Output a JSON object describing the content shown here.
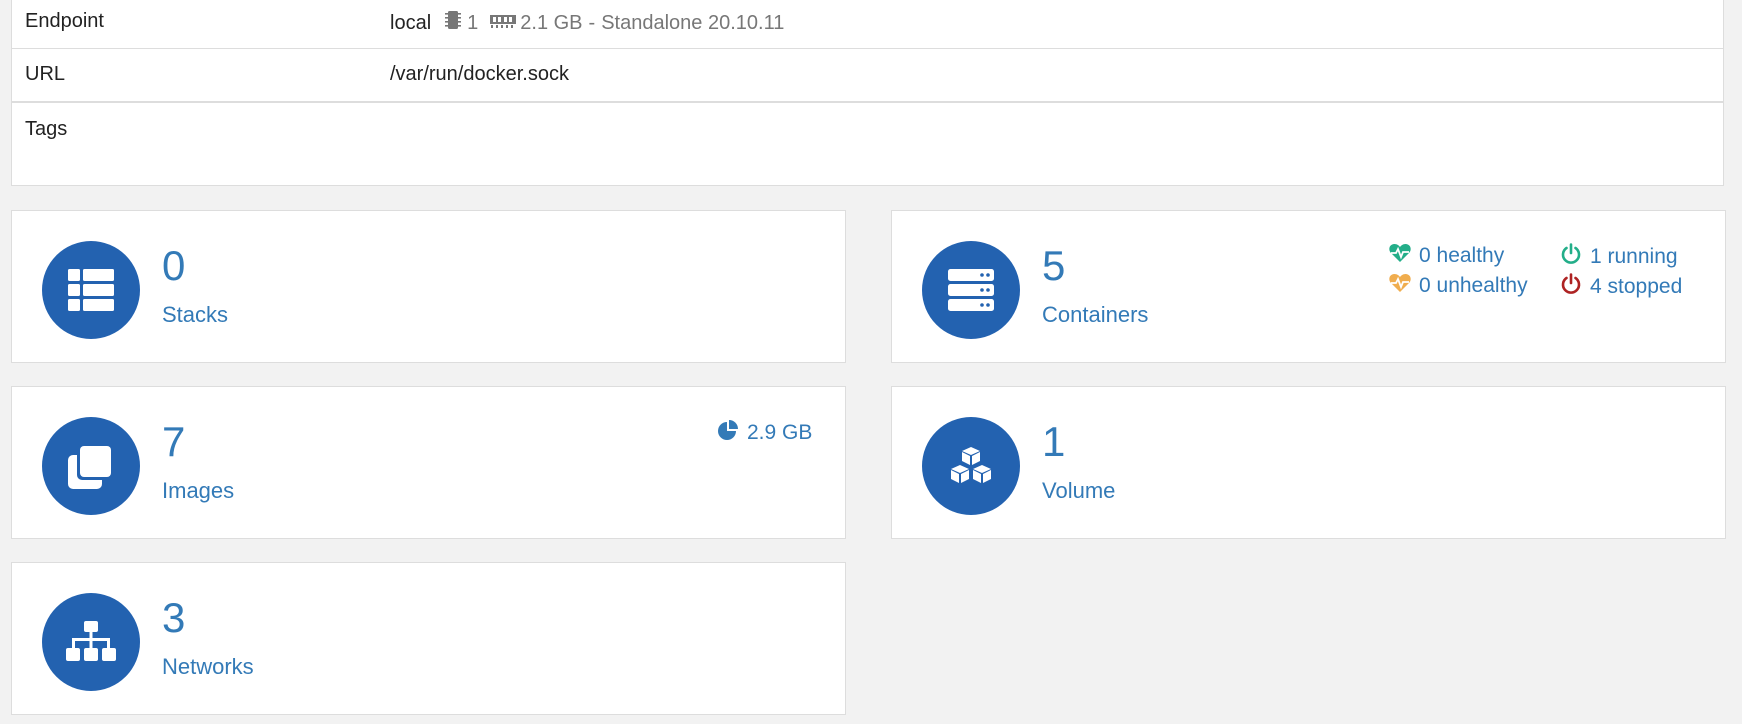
{
  "endpoint_info": {
    "endpoint_label": "Endpoint",
    "endpoint_name": "local",
    "cpu_count": "1",
    "memory": "2.1 GB",
    "separator": "-",
    "docker_mode": "Standalone 20.10.11",
    "url_label": "URL",
    "url_value": "/var/run/docker.sock",
    "tags_label": "Tags"
  },
  "stacks": {
    "count": "0",
    "label": "Stacks",
    "icon": "list-icon"
  },
  "containers": {
    "count": "5",
    "label": "Containers",
    "icon": "server-icon",
    "healthy": "0 healthy",
    "unhealthy": "0 unhealthy",
    "running": "1 running",
    "stopped": "4 stopped"
  },
  "images": {
    "count": "7",
    "label": "Images",
    "icon": "clone-icon",
    "size": "2.9 GB"
  },
  "volumes": {
    "count": "1",
    "label": "Volume",
    "icon": "cubes-icon"
  },
  "networks": {
    "count": "3",
    "label": "Networks",
    "icon": "sitemap-icon"
  },
  "colors": {
    "accent": "#337ab7",
    "icon_circle": "#2362b0",
    "healthy": "#23ae89",
    "running": "#23ae89",
    "unhealthy": "#f0ad4e",
    "stopped": "#ae2323"
  }
}
